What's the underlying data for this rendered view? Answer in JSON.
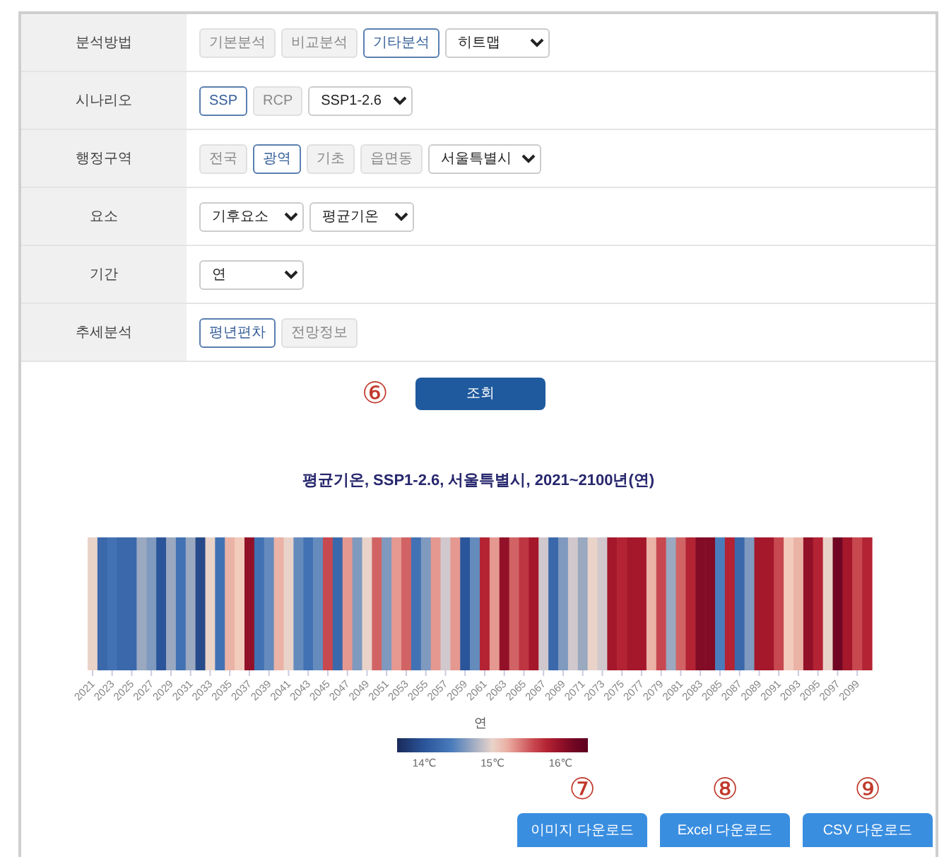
{
  "form": {
    "rows": [
      {
        "label": "분석방법",
        "controls": [
          {
            "kind": "toggle",
            "label": "기본분석",
            "selected": false
          },
          {
            "kind": "toggle",
            "label": "비교분석",
            "selected": false
          },
          {
            "kind": "toggle",
            "label": "기타분석",
            "selected": true
          },
          {
            "kind": "select",
            "value": "히트맵"
          }
        ]
      },
      {
        "label": "시나리오",
        "controls": [
          {
            "kind": "toggle",
            "label": "SSP",
            "selected": true
          },
          {
            "kind": "toggle",
            "label": "RCP",
            "selected": false
          },
          {
            "kind": "select",
            "value": "SSP1-2.6"
          }
        ]
      },
      {
        "label": "행정구역",
        "controls": [
          {
            "kind": "toggle",
            "label": "전국",
            "selected": false
          },
          {
            "kind": "toggle",
            "label": "광역",
            "selected": true
          },
          {
            "kind": "toggle",
            "label": "기초",
            "selected": false
          },
          {
            "kind": "toggle",
            "label": "읍면동",
            "selected": false
          },
          {
            "kind": "select",
            "value": "서울특별시"
          }
        ]
      },
      {
        "label": "요소",
        "controls": [
          {
            "kind": "select",
            "value": "기후요소"
          },
          {
            "kind": "select",
            "value": "평균기온"
          }
        ]
      },
      {
        "label": "기간",
        "controls": [
          {
            "kind": "select",
            "value": "연"
          }
        ]
      },
      {
        "label": "추세분석",
        "controls": [
          {
            "kind": "toggle",
            "label": "평년편차",
            "selected": true
          },
          {
            "kind": "toggle",
            "label": "전망정보",
            "selected": false
          }
        ]
      }
    ]
  },
  "search_button": {
    "marker": "⑥",
    "label": "조회"
  },
  "heatmap": {
    "title": "평균기온, SSP1-2.6, 서울특별시, 2021~2100년(연)",
    "xlabel": "연",
    "year_labels": [
      "2021",
      "2023",
      "2025",
      "2027",
      "2029",
      "2031",
      "2033",
      "2035",
      "2037",
      "2039",
      "2041",
      "2043",
      "2045",
      "2047",
      "2049",
      "2051",
      "2053",
      "2055",
      "2057",
      "2059",
      "2061",
      "2063",
      "2065",
      "2067",
      "2069",
      "2071",
      "2073",
      "2075",
      "2077",
      "2079",
      "2081",
      "2083",
      "2085",
      "2087",
      "2089",
      "2091",
      "2093",
      "2095",
      "2097",
      "2099"
    ],
    "legend_labels": [
      "14℃",
      "15℃",
      "16℃"
    ]
  },
  "downloads": [
    {
      "marker": "⑦",
      "label": "이미지 다운로드"
    },
    {
      "marker": "⑧",
      "label": "Excel 다운로드"
    },
    {
      "marker": "⑨",
      "label": "CSV 다운로드"
    }
  ]
}
